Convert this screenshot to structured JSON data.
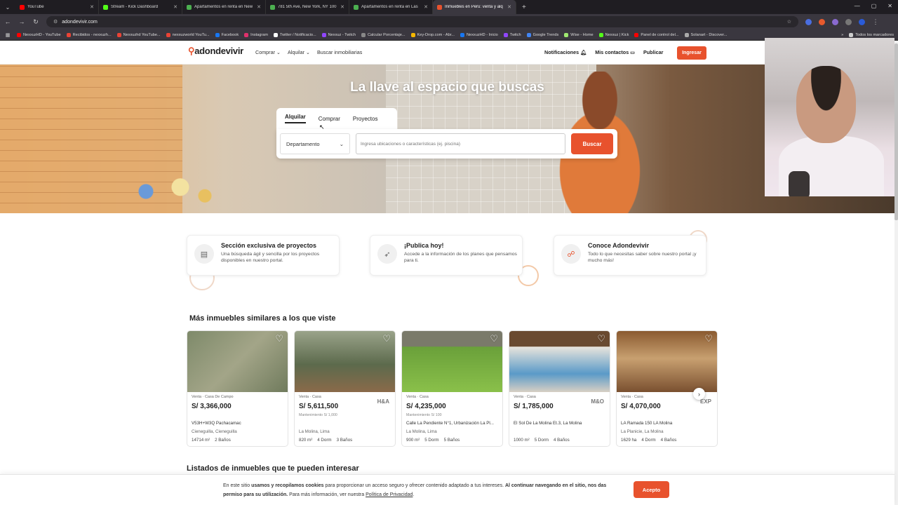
{
  "browser": {
    "tabs": [
      {
        "label": "YouTube",
        "color": "#ff0000"
      },
      {
        "label": "Stream - Kick Dashboard",
        "color": "#53fc18"
      },
      {
        "label": "Apartamentos en renta en New",
        "color": "#4caf50"
      },
      {
        "label": "781 5th Ave, New York, NY 100",
        "color": "#4caf50"
      },
      {
        "label": "Apartamentos en renta en Las",
        "color": "#4caf50"
      },
      {
        "label": "Inmuebles en Perú: venta y alq",
        "color": "#e8522d"
      }
    ],
    "new_tab": "+",
    "url": "adondevivir.com",
    "bookmarks": [
      {
        "label": "NexxuzHD - YouTube",
        "color": "#ff0000"
      },
      {
        "label": "Recibidos - nexxuzh...",
        "color": "#ea4335"
      },
      {
        "label": "Nexxuzhd YouTube...",
        "color": "#ea4335"
      },
      {
        "label": "nexxuzworld YouTu...",
        "color": "#ea4335"
      },
      {
        "label": "Facebook",
        "color": "#1877f2"
      },
      {
        "label": "Instagram",
        "color": "#e1306c"
      },
      {
        "label": "Twitter / Notificacio...",
        "color": "#ffffff"
      },
      {
        "label": "Nexxuz - Twitch",
        "color": "#9146ff"
      },
      {
        "label": "Calcular Porcentaje...",
        "color": "#888888"
      },
      {
        "label": "Key-Drop.com - Abr...",
        "color": "#f5b700"
      },
      {
        "label": "NexxuzHD - Inicio",
        "color": "#1877f2"
      },
      {
        "label": "Twitch",
        "color": "#9146ff"
      },
      {
        "label": "Google Trends",
        "color": "#4285f4"
      },
      {
        "label": "Wise - Home",
        "color": "#9fe870"
      },
      {
        "label": "Nexxuz | Kick",
        "color": "#53fc18"
      },
      {
        "label": "Panel de control del...",
        "color": "#ff0000"
      },
      {
        "label": "Solanart - Discover...",
        "color": "#aaaaaa"
      }
    ],
    "all_bookmarks": "Todos los marcadores"
  },
  "site": {
    "brand": "adondevivir",
    "nav": [
      "Comprar",
      "Alquilar",
      "Buscar inmobiliarias"
    ],
    "notificaciones": "Notificaciones",
    "mis_contactos": "Mis contactos",
    "publicar": "Publicar",
    "ingresar": "Ingresar",
    "accent": "#e8522d"
  },
  "hero": {
    "title": "La llave al espacio que buscas",
    "tabs": [
      "Alquilar",
      "Comprar",
      "Proyectos"
    ],
    "select_value": "Departamento",
    "search_placeholder": "Ingresa ubicaciones o características (ej. piscina)",
    "search_button": "Buscar"
  },
  "features": [
    {
      "title": "Sección exclusiva de proyectos",
      "desc": "Una búsqueda ágil y sencilla por los proyectos disponibles en nuestro portal."
    },
    {
      "title": "¡Publica hoy!",
      "desc": "Accede a la información de los planes que pensamos para ti."
    },
    {
      "title": "Conoce Adondevivir",
      "desc": "Todo lo que necesitas saber sobre nuestro portal ¡y mucho más!"
    }
  ],
  "similar": {
    "title": "Más inmuebles similares a los que viste",
    "cards": [
      {
        "type": "Venta · Casa De Campo",
        "price": "S/ 3,366,000",
        "maint": "",
        "addr": "V53H+W3Q Pachacamac",
        "city": "Cieneguilla, Cieneguilla",
        "features": [
          "14714 m²",
          "2 Baños"
        ],
        "logo": ""
      },
      {
        "type": "Venta · Casa",
        "price": "S/ 5,611,500",
        "maint": "Mantenimiento S/ 1,000",
        "addr": "",
        "city": "La Molina, Lima",
        "features": [
          "820 m²",
          "4 Dorm",
          "3 Baños"
        ],
        "logo": "H&A"
      },
      {
        "type": "Venta · Casa",
        "price": "S/ 4,235,000",
        "maint": "Mantenimiento S/ 100",
        "addr": "Calle La Pendiente N°1, Urbanización La Pl...",
        "city": "La Molina, Lima",
        "features": [
          "900 m²",
          "5 Dorm",
          "5 Baños"
        ],
        "logo": ""
      },
      {
        "type": "Venta · Casa",
        "price": "S/ 1,785,000",
        "maint": "",
        "addr": "El Sol De La Molina Et.3, La Molina",
        "city": "",
        "features": [
          "1000 m²",
          "5 Dorm",
          "4 Baños"
        ],
        "logo": "M&O"
      },
      {
        "type": "Venta · Casa",
        "price": "S/ 4,070,000",
        "maint": "",
        "addr": "LA Ramada 150 LA Molina",
        "city": "La Planicie, La Molina",
        "features": [
          "1629 ha",
          "4 Dorm",
          "4 Baños"
        ],
        "logo": "EXP"
      }
    ]
  },
  "listados_title": "Listados de inmuebles que te pueden interesar",
  "cookie": {
    "p1": "En este sitio ",
    "b1": "usamos y recopilamos cookies",
    "p2": " para proporcionar un acceso seguro y ofrecer contenido adaptado a tus intereses. ",
    "b2": "Al continuar navegando en el sitio, nos das permiso para su utilización.",
    "p3": " Para más información, ver nuestra ",
    "link": "Política de Privacidad",
    "p4": ".",
    "accept": "Acepto"
  }
}
